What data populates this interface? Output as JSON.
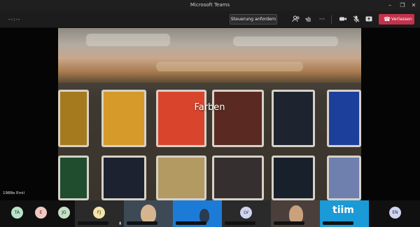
{
  "window": {
    "title": "Microsoft Teams",
    "minimize": "–",
    "maximize": "❐",
    "close": "✕"
  },
  "toolbar": {
    "timer": "--:--",
    "request_control": "Steuerung anfordern",
    "more": "···",
    "leave": "Verlassen"
  },
  "share": {
    "title": "Farben",
    "presenter": "1988e Emil"
  },
  "participants": {
    "ta": "TA",
    "e": "E",
    "jg": "JG",
    "fj": "FJ",
    "lv": "LV",
    "en": "EN",
    "brand": "tiim"
  },
  "colors": {
    "leave": "#c4314b",
    "avatar_ta": "#b9e2c8",
    "avatar_e": "#f3c7c2",
    "avatar_jg": "#c5e0c5",
    "avatar_fj": "#f5e3a8",
    "avatar_lv": "#cfd4f0",
    "avatar_en": "#cfd4f0",
    "tile_blue": "#1d7bd8"
  }
}
